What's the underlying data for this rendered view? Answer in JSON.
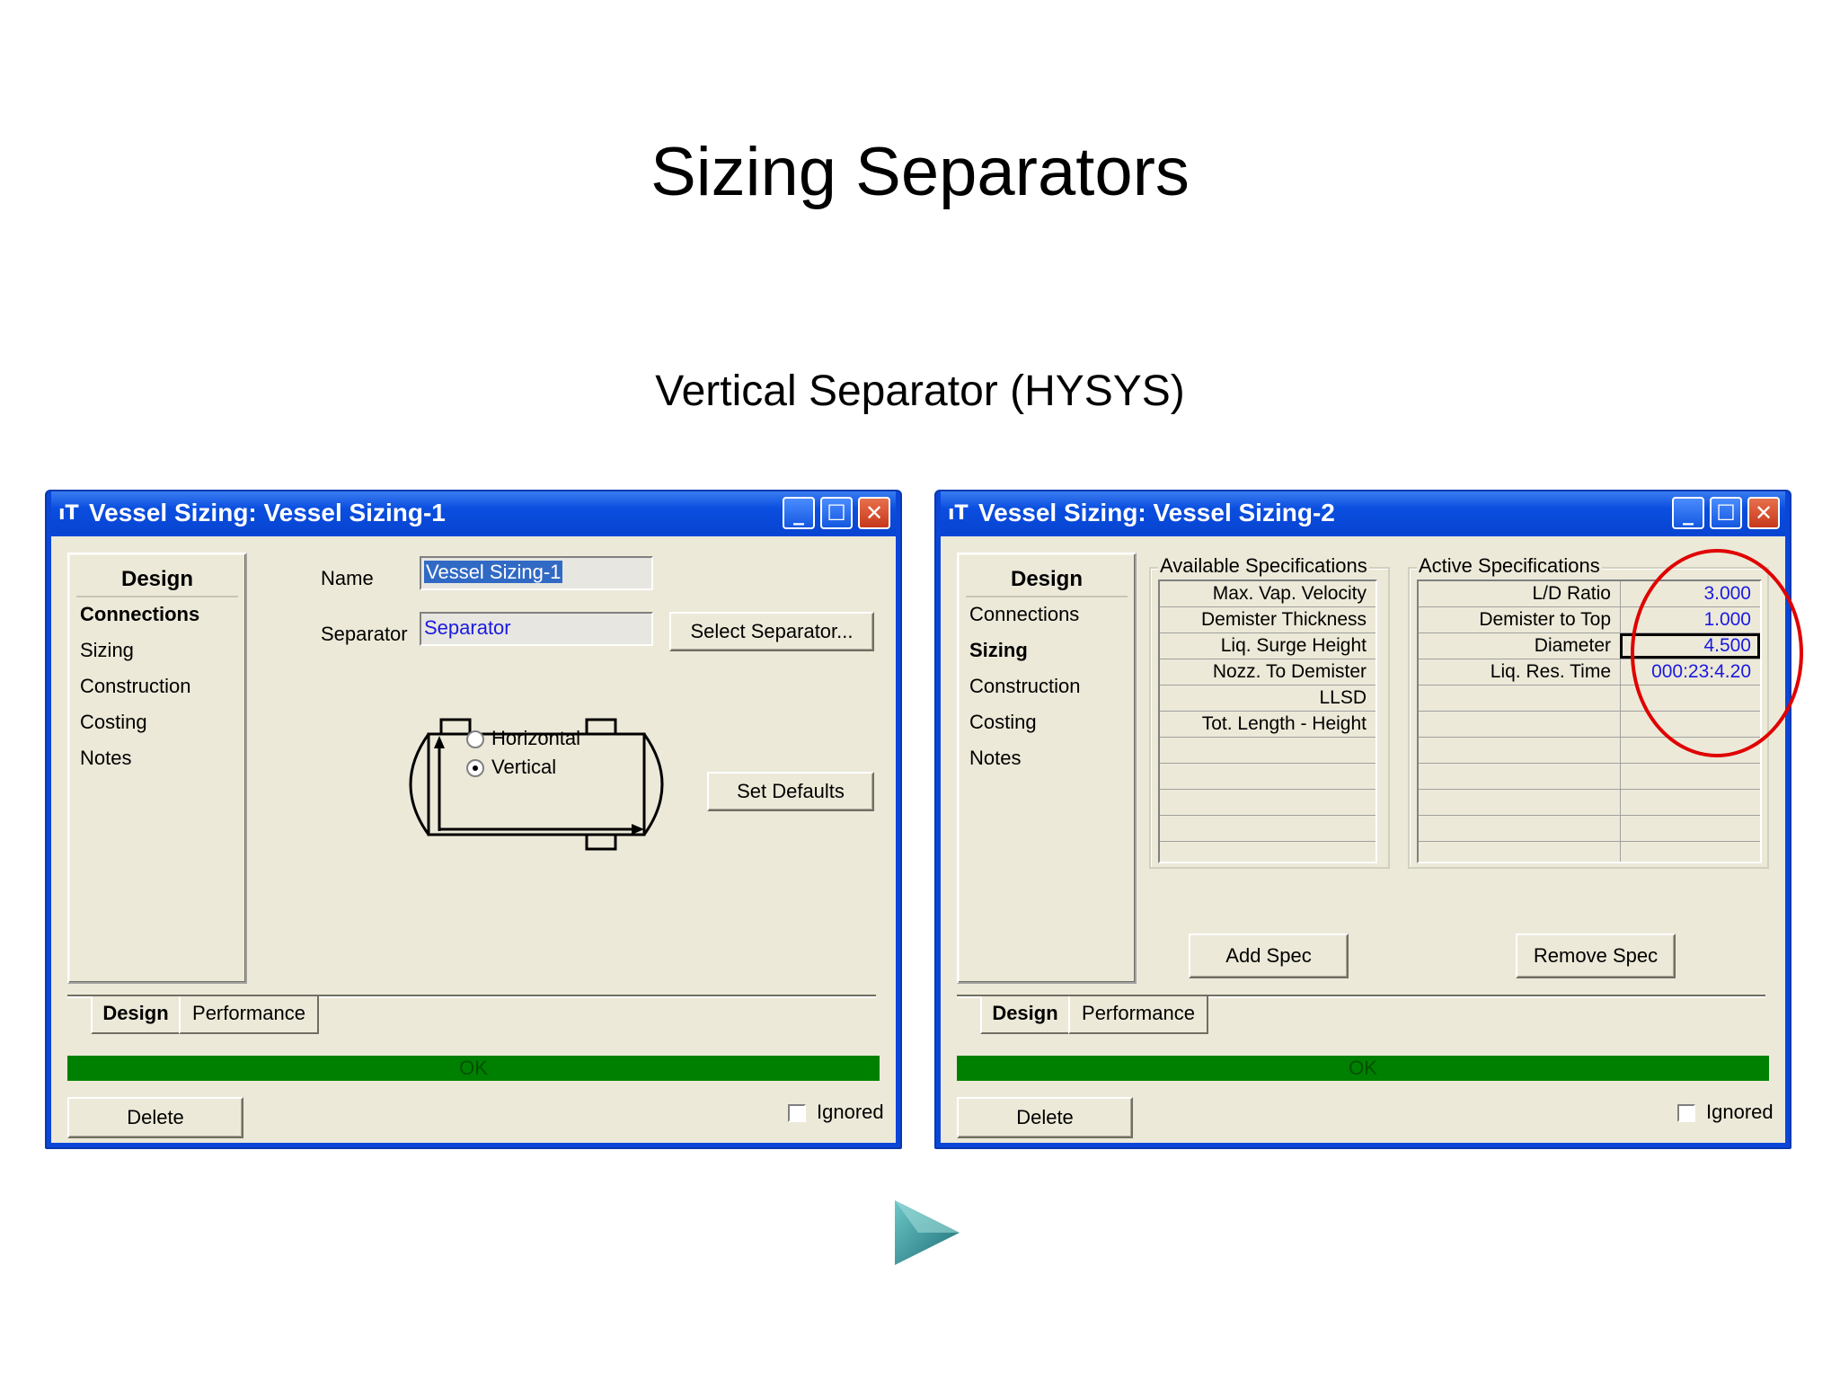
{
  "slide": {
    "title": "Sizing Separators",
    "subtitle": "Vertical Separator (HYSYS)"
  },
  "colors": {
    "titlebar": "#0a46d8",
    "status_ok": "#008000",
    "annotation_circle": "#e00000",
    "value_text": "#1a1ae0"
  },
  "window1": {
    "title": "Vessel Sizing: Vessel Sizing-1",
    "nav": {
      "header": "Design",
      "items": [
        "Connections",
        "Sizing",
        "Construction",
        "Costing",
        "Notes"
      ],
      "selected": "Connections"
    },
    "name_label": "Name",
    "name_value": "Vessel Sizing-1",
    "separator_label": "Separator",
    "separator_value": "Separator",
    "select_button": "Select Separator...",
    "orientation": {
      "options": [
        "Horizontal",
        "Vertical"
      ],
      "selected": "Vertical"
    },
    "set_defaults_button": "Set Defaults",
    "tabs": [
      "Design",
      "Performance"
    ],
    "active_tab": "Design",
    "status": "OK",
    "delete_button": "Delete",
    "ignored_label": "Ignored"
  },
  "window2": {
    "title": "Vessel Sizing: Vessel Sizing-2",
    "nav": {
      "header": "Design",
      "items": [
        "Connections",
        "Sizing",
        "Construction",
        "Costing",
        "Notes"
      ],
      "selected": "Sizing"
    },
    "available_label": "Available Specifications",
    "available_specs": [
      "Max. Vap. Velocity",
      "Demister Thickness",
      "Liq. Surge Height",
      "Nozz. To Demister",
      "LLSD",
      "Tot. Length - Height"
    ],
    "active_label": "Active Specifications",
    "active_specs": [
      {
        "name": "L/D Ratio",
        "value": "3.000"
      },
      {
        "name": "Demister to Top",
        "value": "1.000"
      },
      {
        "name": "Diameter",
        "value": "4.500"
      },
      {
        "name": "Liq. Res. Time",
        "value": "000:23:4.20"
      }
    ],
    "add_spec_button": "Add Spec",
    "remove_spec_button": "Remove Spec",
    "tabs": [
      "Design",
      "Performance"
    ],
    "active_tab": "Design",
    "status": "OK",
    "delete_button": "Delete",
    "ignored_label": "Ignored"
  },
  "next_arrow_icon": "play-arrow-icon"
}
